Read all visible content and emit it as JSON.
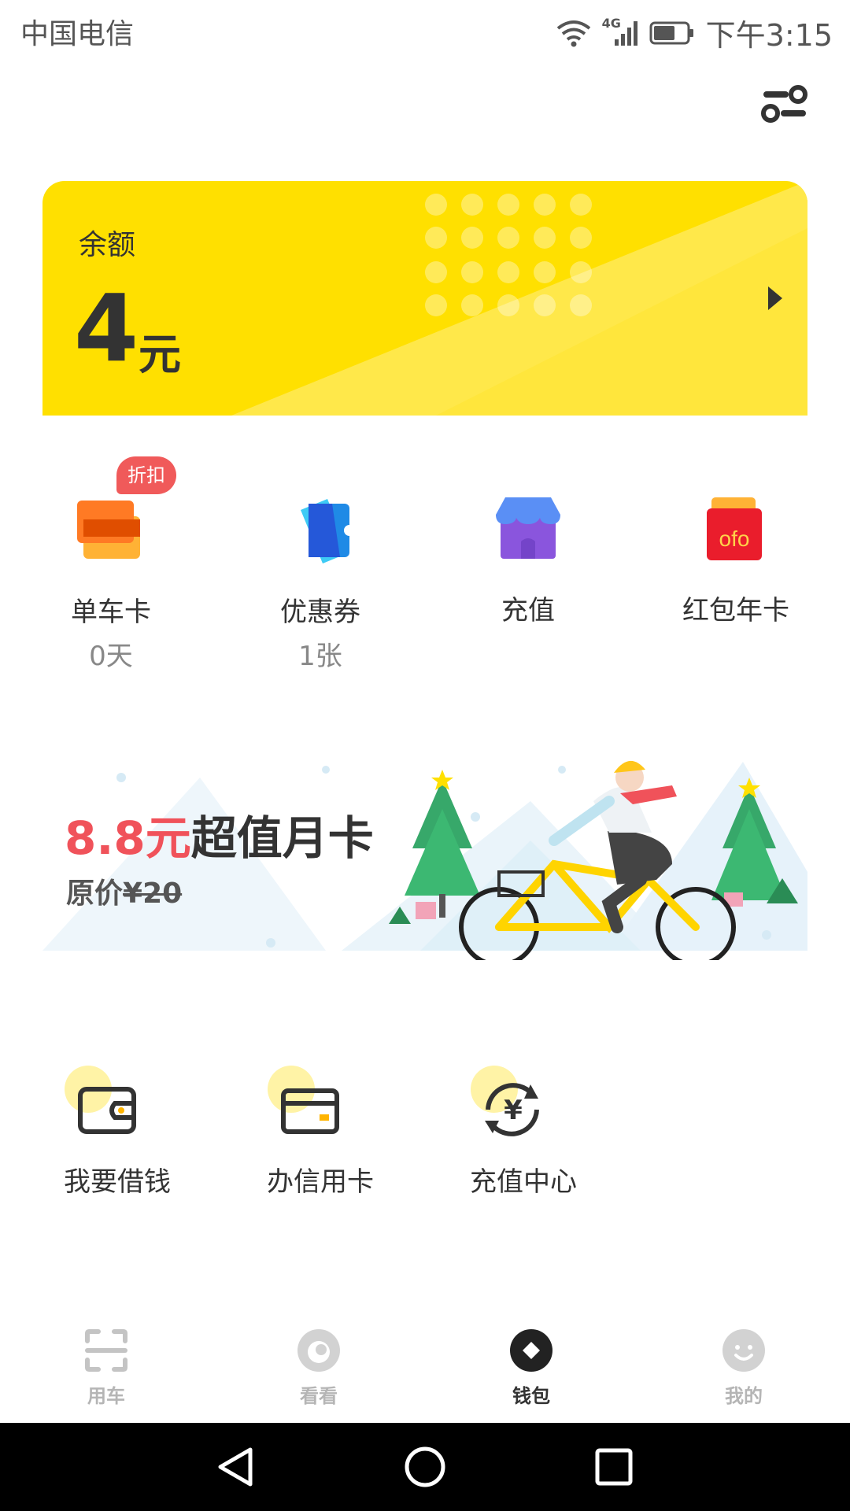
{
  "status_bar": {
    "carrier": "中国电信",
    "network": "4G",
    "time": "下午3:15"
  },
  "balance": {
    "label": "余额",
    "amount": "4",
    "unit": "元"
  },
  "quick_actions": [
    {
      "label": "单车卡",
      "sub": "0天",
      "badge": "折扣",
      "icon": "bike-card-icon"
    },
    {
      "label": "优惠券",
      "sub": "1张",
      "icon": "coupon-icon"
    },
    {
      "label": "充值",
      "icon": "recharge-shop-icon"
    },
    {
      "label": "红包年卡",
      "icon": "red-packet-icon",
      "icon_text": "ofo"
    }
  ],
  "promo": {
    "price": "8.8元",
    "title": "超值月卡",
    "orig_prefix": "原价",
    "orig_price": "¥20"
  },
  "services": [
    {
      "label": "我要借钱",
      "icon": "wallet-icon"
    },
    {
      "label": "办信用卡",
      "icon": "credit-card-icon"
    },
    {
      "label": "充值中心",
      "icon": "yuan-exchange-icon"
    }
  ],
  "tabs": [
    {
      "label": "用车",
      "icon": "scan-icon",
      "active": false
    },
    {
      "label": "看看",
      "icon": "eye-icon",
      "active": false
    },
    {
      "label": "钱包",
      "icon": "wallet-diamond-icon",
      "active": true
    },
    {
      "label": "我的",
      "icon": "smiley-icon",
      "active": false
    }
  ],
  "colors": {
    "accent_yellow": "#ffe000",
    "badge_red": "#f05a5a",
    "price_red": "#f0525a",
    "text_dark": "#333333",
    "tab_inactive": "#b5b5b5"
  }
}
